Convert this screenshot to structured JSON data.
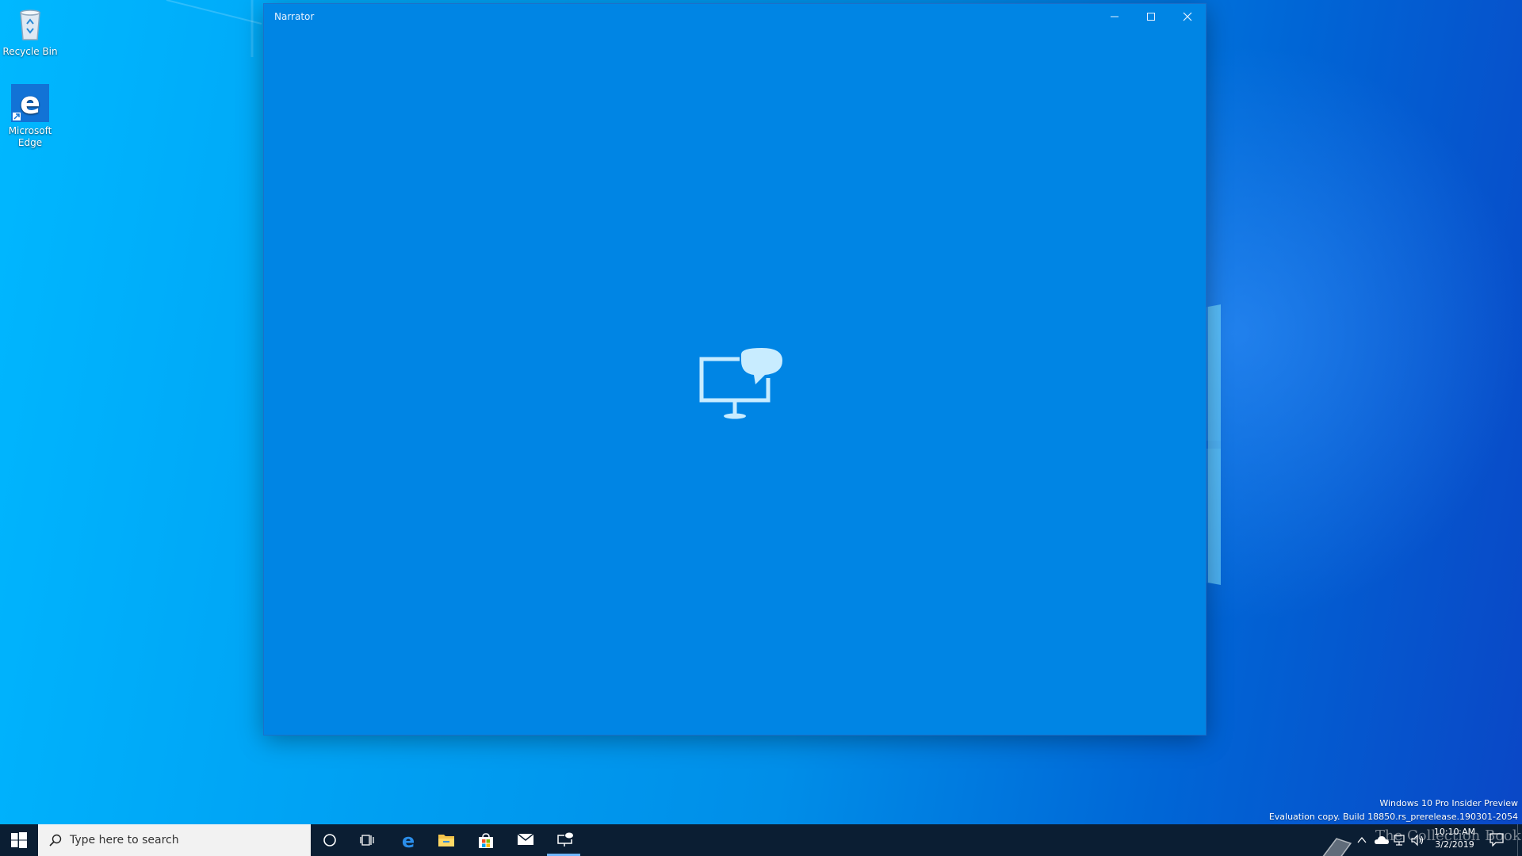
{
  "desktop": {
    "icons": [
      {
        "label": "Recycle Bin",
        "icon": "recycle-bin-icon"
      },
      {
        "label": "Microsoft Edge",
        "icon": "edge-icon"
      }
    ],
    "watermark_line1": "Windows 10 Pro Insider Preview",
    "watermark_line2": "Evaluation copy. Build 18850.rs_prerelease.190301-2054",
    "collection_text": "The Collection Book"
  },
  "window": {
    "title": "Narrator",
    "icon": "narrator-icon",
    "buttons": [
      "minimize-icon",
      "maximize-icon",
      "close-icon"
    ]
  },
  "taskbar": {
    "search_placeholder": "Type here to search",
    "pinned": [
      "cortana-icon",
      "task-view-icon",
      "edge-icon",
      "file-explorer-icon",
      "store-icon",
      "mail-icon"
    ],
    "tray": [
      "chevron-up-icon",
      "onedrive-icon",
      "network-icon",
      "volume-icon"
    ],
    "time": "10:10 AM",
    "date": "3/2/2019"
  },
  "colors": {
    "window_bg": "#0085e4",
    "taskbar_bg": "#0b1e33",
    "accent": "#6fb6ff"
  }
}
